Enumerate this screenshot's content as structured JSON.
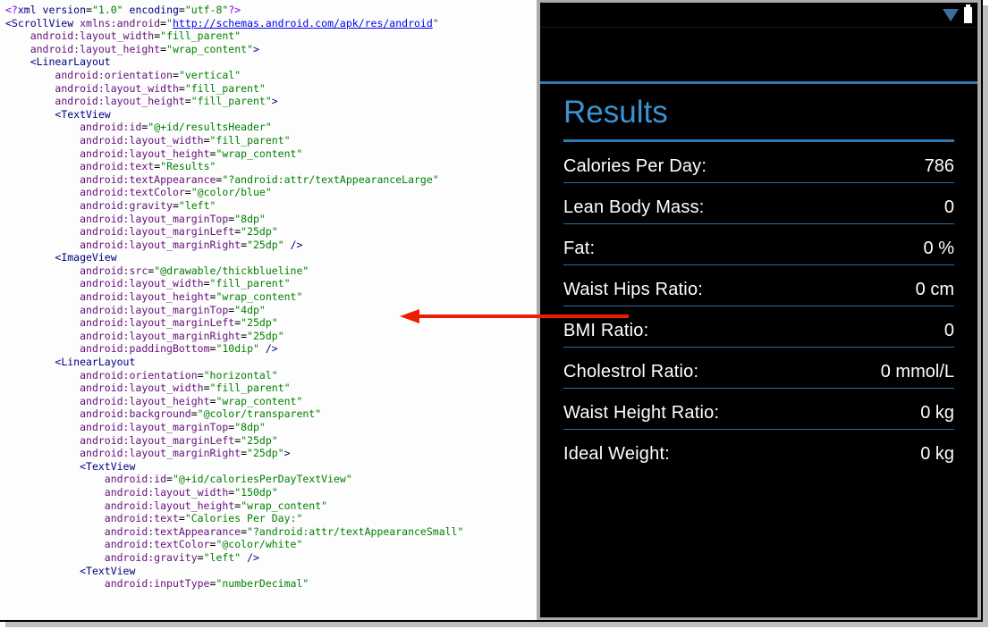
{
  "code": {
    "xmlns_url": "http://schemas.android.com/apk/res/android",
    "scrollview": {
      "layout_width": "fill_parent",
      "layout_height": "wrap_content"
    },
    "linearlayout1": {
      "orientation": "vertical",
      "layout_width": "fill_parent",
      "layout_height": "fill_parent"
    },
    "textview1": {
      "id": "@+id/resultsHeader",
      "layout_width": "fill_parent",
      "layout_height": "wrap_content",
      "text": "Results",
      "textAppearance": "?android:attr/textAppearanceLarge",
      "textColor": "@color/blue",
      "gravity": "left",
      "layout_marginTop": "8dp",
      "layout_marginLeft": "25dp",
      "layout_marginRight": "25dp"
    },
    "imageview": {
      "src": "@drawable/thickblueline",
      "layout_width": "fill_parent",
      "layout_height": "wrap_content",
      "layout_marginTop": "4dp",
      "layout_marginLeft": "25dp",
      "layout_marginRight": "25dp",
      "paddingBottom": "10dip"
    },
    "linearlayout2": {
      "orientation": "horizontal",
      "layout_width": "fill_parent",
      "layout_height": "wrap_content",
      "background": "@color/transparent",
      "layout_marginTop": "8dp",
      "layout_marginLeft": "25dp",
      "layout_marginRight": "25dp"
    },
    "textview2": {
      "id": "@+id/caloriesPerDayTextView",
      "layout_width": "150dp",
      "layout_height": "wrap_content",
      "text": "Calories Per Day:",
      "textAppearance": "?android:attr/textAppearanceSmall",
      "textColor": "@color/white",
      "gravity": "left"
    },
    "textview3": {
      "inputType": "numberDecimal"
    }
  },
  "phone": {
    "header": "Results",
    "rows": [
      {
        "label": "Calories Per Day:",
        "value": "786"
      },
      {
        "label": "Lean Body Mass:",
        "value": "0"
      },
      {
        "label": "Fat:",
        "value": "0 %"
      },
      {
        "label": "Waist Hips Ratio:",
        "value": "0 cm"
      },
      {
        "label": "BMI Ratio:",
        "value": "0"
      },
      {
        "label": "Cholestrol Ratio:",
        "value": "0 mmol/L"
      },
      {
        "label": "Waist Height Ratio:",
        "value": "0 kg"
      },
      {
        "label": "Ideal Weight:",
        "value": "0 kg"
      }
    ]
  }
}
